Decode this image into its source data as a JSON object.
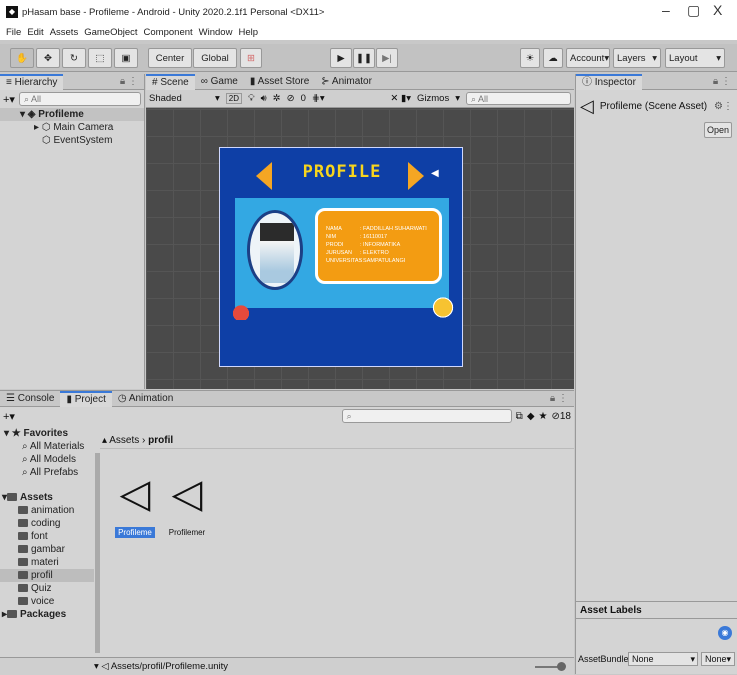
{
  "window": {
    "title": "pHasam base - Profileme - Android - Unity 2020.2.1f1 Personal <DX11>",
    "minimize": "–",
    "maximize": "▢",
    "close": "X"
  },
  "menu": [
    "File",
    "Edit",
    "Assets",
    "GameObject",
    "Component",
    "Window",
    "Help"
  ],
  "toolbar": {
    "pivot": "Center",
    "space": "Global",
    "account": "Account",
    "layers": "Layers",
    "layout": "Layout"
  },
  "hierarchy": {
    "tab": "Hierarchy",
    "search_placeholder": "All",
    "scene": "Profileme",
    "items": [
      "Main Camera",
      "EventSystem"
    ]
  },
  "scene_view": {
    "tabs": [
      "Scene",
      "Game",
      "Asset Store",
      "Animator"
    ],
    "shading": "Shaded",
    "mode2d": "2D",
    "gizmos": "Gizmos",
    "search_placeholder": "All",
    "hidden_count": "0",
    "game": {
      "title": "PROFILE",
      "rows": [
        {
          "label": "NAMA",
          "value": ": FADDILLAH SUHARWATI"
        },
        {
          "label": "NIM",
          "value": ": 16110017"
        },
        {
          "label": "PRODI",
          "value": ": INFORMATIKA"
        },
        {
          "label": "JURUSAN",
          "value": ": ELEKTRO"
        },
        {
          "label": "UNIVERSITAS",
          "value": ": SAMPATULANGI"
        }
      ]
    }
  },
  "inspector": {
    "tab": "Inspector",
    "asset": "Profileme (Scene Asset)",
    "open": "Open",
    "labels_header": "Asset Labels",
    "bundle_label": "AssetBundle",
    "bundle_value": "None",
    "variant_value": "None"
  },
  "bottom": {
    "tabs": [
      "Console",
      "Project",
      "Animation"
    ],
    "favorites": "Favorites",
    "fav_items": [
      "All Materials",
      "All Models",
      "All Prefabs"
    ],
    "assets_root": "Assets",
    "folders": [
      "animation",
      "coding",
      "font",
      "gambar",
      "materi",
      "profil",
      "Quiz",
      "voice"
    ],
    "packages": "Packages",
    "breadcrumb": [
      "Assets",
      "profil"
    ],
    "files": [
      "Profileme",
      "Profilemer"
    ],
    "path": "Assets/profil/Profileme.unity",
    "hidden_count": "18"
  }
}
